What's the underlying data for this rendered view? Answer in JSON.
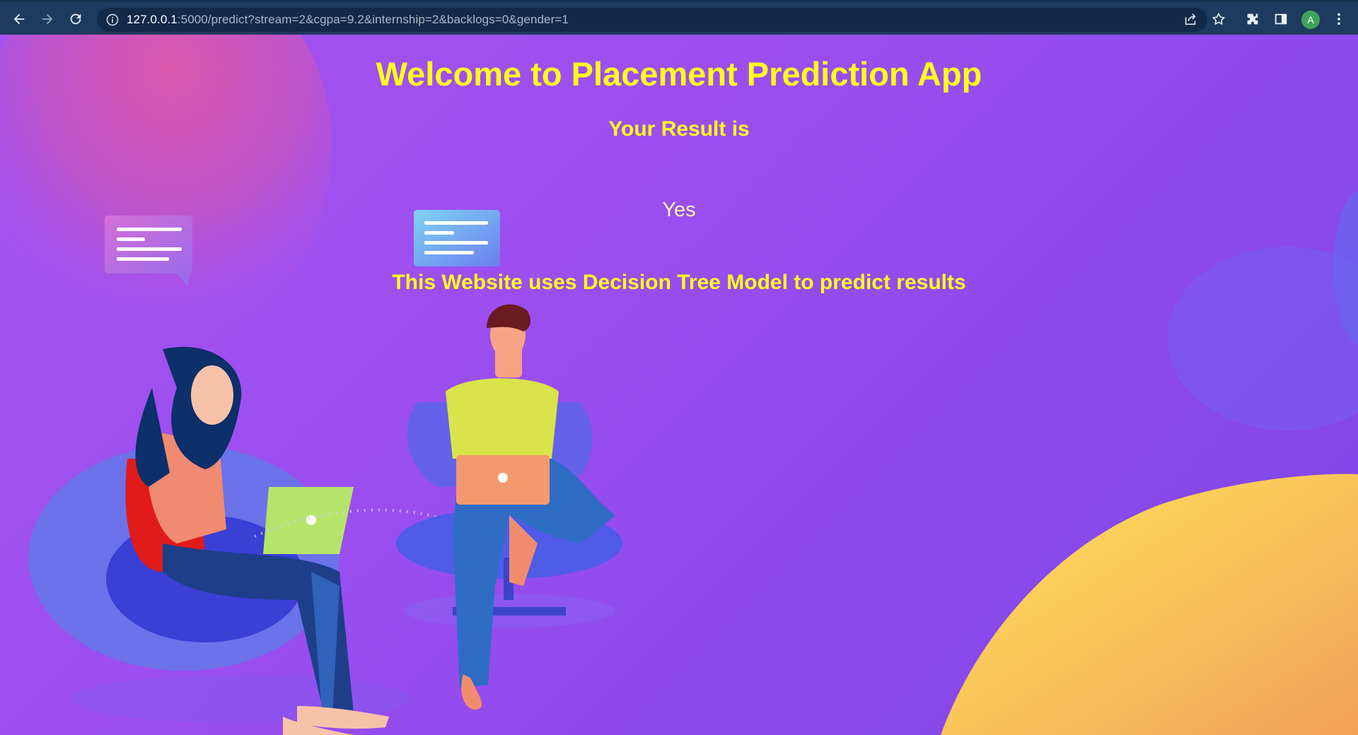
{
  "browser": {
    "url_host": "127.0.0.1",
    "url_path": ":5000/predict?stream=2&cgpa=9.2&internship=2&backlogs=0&gender=1",
    "profile_initial": "A",
    "icons": [
      "back-arrow-icon",
      "forward-arrow-icon",
      "reload-icon",
      "info-icon",
      "share-icon",
      "star-icon",
      "puzzle-icon",
      "side-panel-icon",
      "kebab-menu-icon"
    ]
  },
  "page": {
    "title": "Welcome to Placement Prediction App",
    "result_heading": "Your Result is",
    "result_value": "Yes",
    "model_note": "This Website uses Decision Tree Model to predict results"
  },
  "colors": {
    "heading": "#ffff1a",
    "result": "#fff6b0",
    "background": "#9b4ef0",
    "toolbar": "#1e3a5e"
  }
}
